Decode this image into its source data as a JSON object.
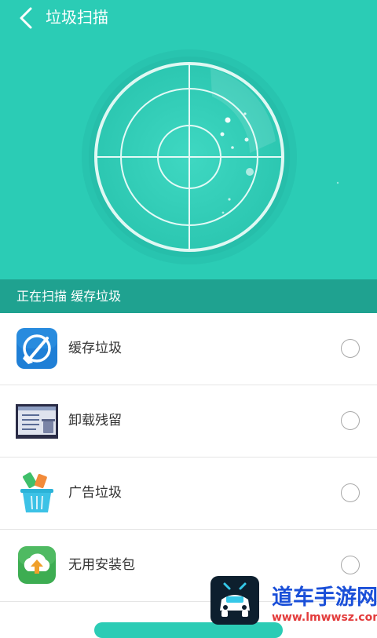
{
  "header": {
    "title": "垃圾扫描",
    "back_icon": "chevron-left-icon"
  },
  "scan": {
    "status_text": "正在扫描 缓存垃圾",
    "visual": "radar-scanner"
  },
  "items": [
    {
      "label": "缓存垃圾",
      "icon": "broom-clean-icon",
      "checked": false
    },
    {
      "label": "卸载残留",
      "icon": "uninstall-residue-icon",
      "checked": false
    },
    {
      "label": "广告垃圾",
      "icon": "trash-basket-icon",
      "checked": false
    },
    {
      "label": "无用安装包",
      "icon": "package-upload-icon",
      "checked": false
    }
  ],
  "watermark": {
    "text": "道车手游网",
    "url": "www.lmwwsz.com",
    "logo": "car-logo-icon"
  },
  "bottom_button": {
    "label": ""
  },
  "colors": {
    "accent": "#2bccb5",
    "status_bar": "#1fa290",
    "divider": "#e5e5e5",
    "watermark_blue": "#1a4fd8",
    "watermark_red": "#e33b3b"
  }
}
